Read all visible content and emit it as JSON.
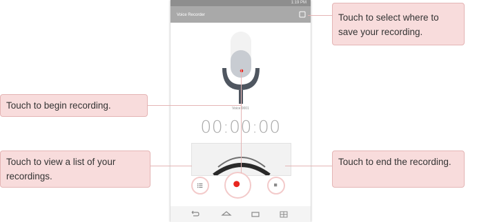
{
  "status_bar": {
    "time": "1:19 PM"
  },
  "app_bar": {
    "title": "Voice Recorder",
    "storage_icon": "storage-select-icon"
  },
  "recording": {
    "name": "Voice 0001",
    "timer": "00:00:00"
  },
  "controls": {
    "list_icon": "list-icon",
    "record_icon": "record-icon",
    "stop_icon": "stop-icon"
  },
  "nav_bar": {
    "icons": [
      "back-icon",
      "home-icon",
      "recent-apps-icon",
      "dual-window-icon"
    ]
  },
  "callouts": {
    "select_location": "Touch to select where to save your recording.",
    "begin": "Touch to begin recording.",
    "list": "Touch to view a list of your recordings.",
    "end": "Touch to end the recording."
  },
  "colors": {
    "accent_red": "#e8261f",
    "callout_fill": "#f8dcdc",
    "callout_border": "#e4b4b4",
    "mic_dark": "#4f5660"
  }
}
